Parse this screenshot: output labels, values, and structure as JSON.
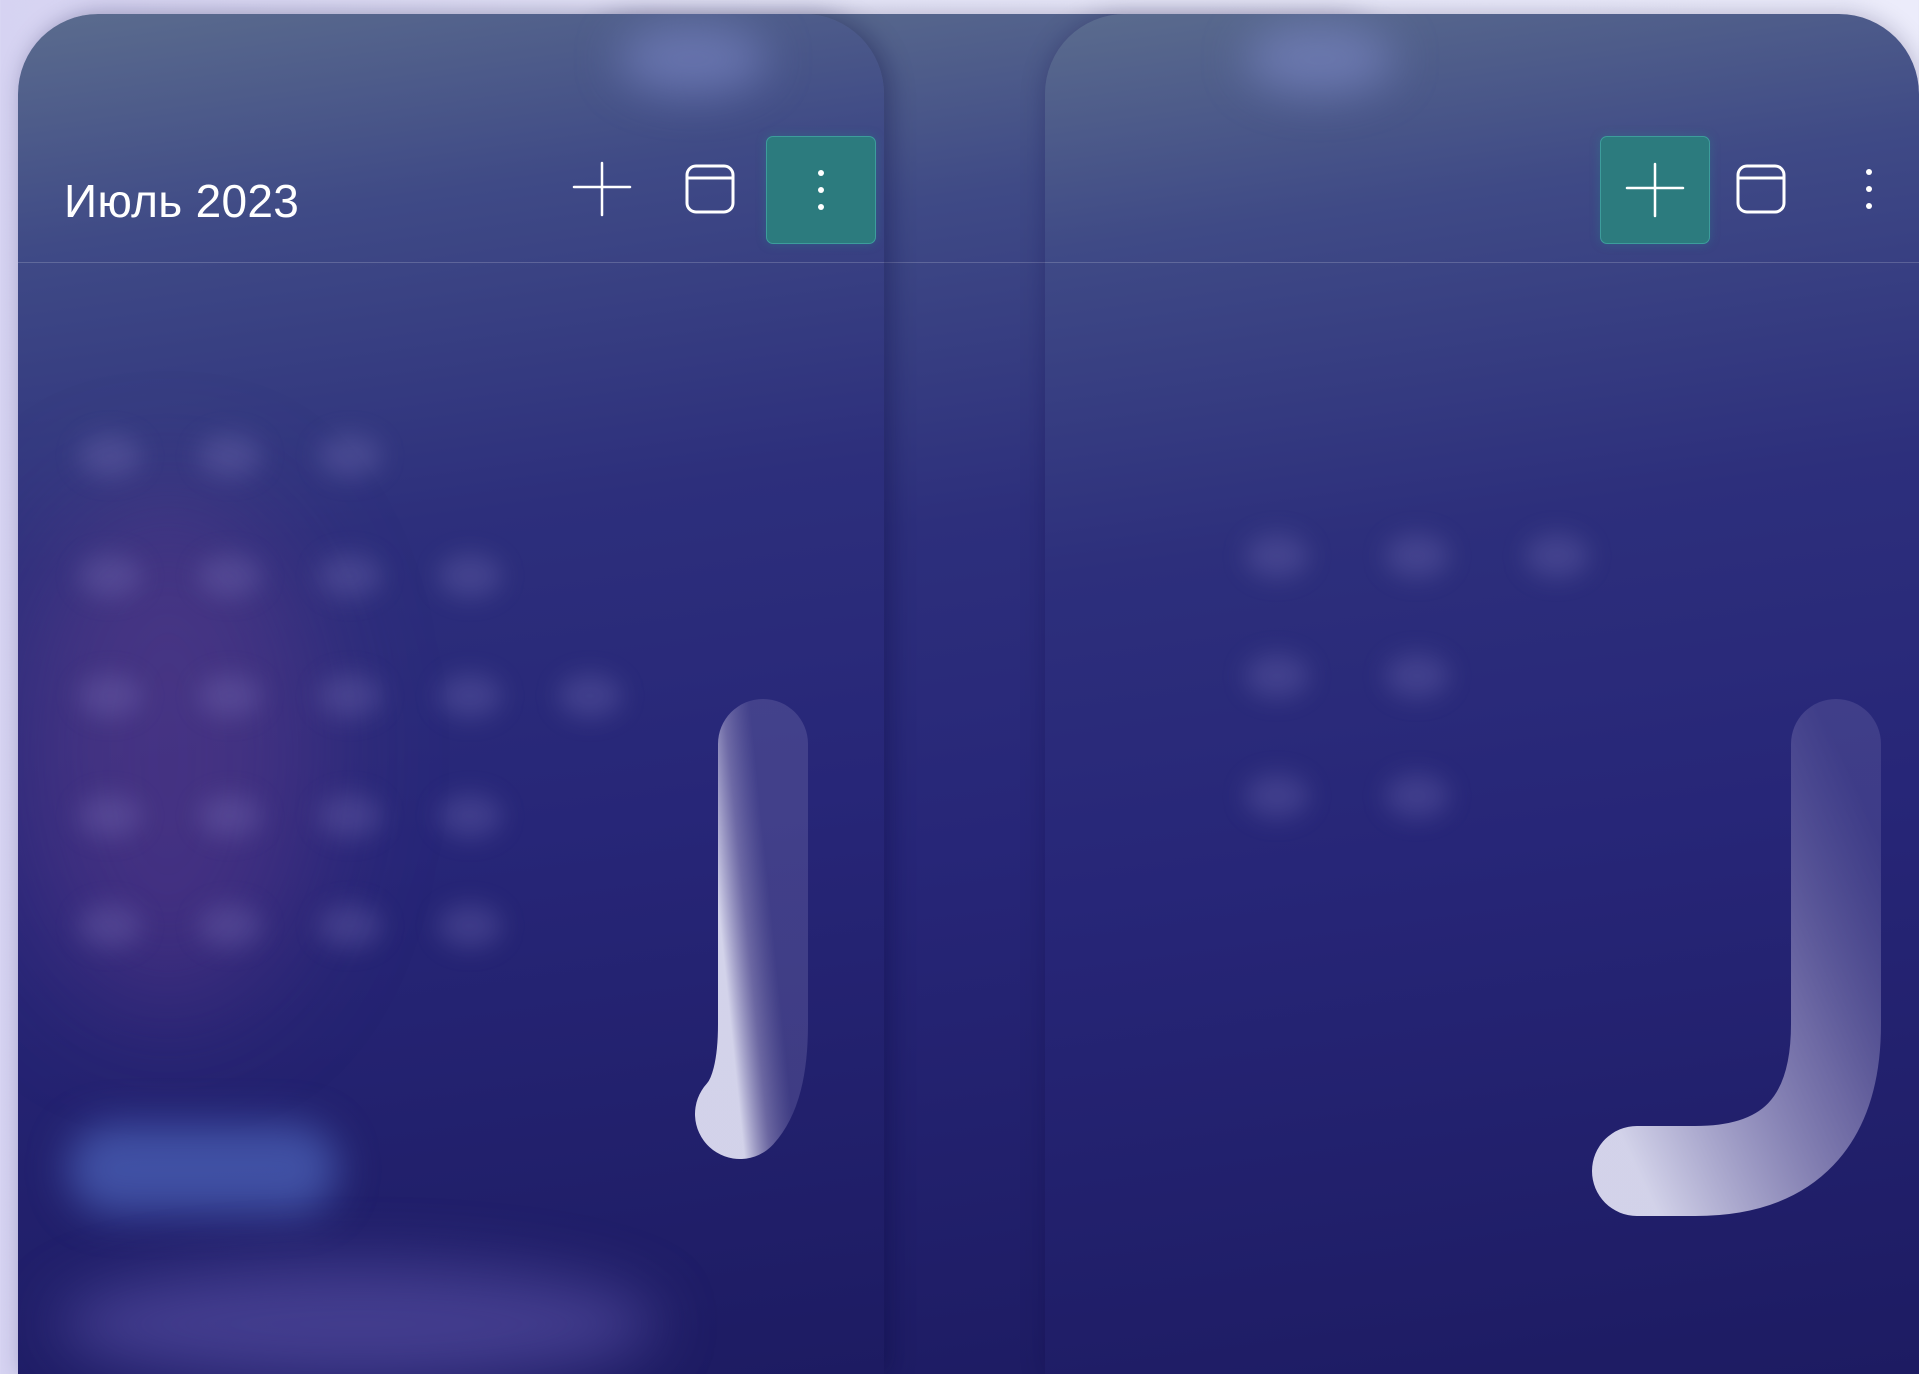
{
  "calendar": {
    "title": "Июль 2023"
  },
  "toolbar_icons": {
    "add": "plus-icon",
    "view": "calendar-view-icon",
    "more": "more-vertical-icon"
  },
  "frames": [
    {
      "active_button": "more",
      "gesture": "swipe-up-curve-short"
    },
    {
      "active_button": "view",
      "gesture": "swipe-left-then-up"
    },
    {
      "active_button": "add",
      "gesture": "swipe-left-then-up"
    }
  ],
  "colors": {
    "active_button": "#2c7b7e",
    "panel_top": "#5b6c8e",
    "panel_bottom": "#1d1b62",
    "background": "#e6e6f8"
  }
}
